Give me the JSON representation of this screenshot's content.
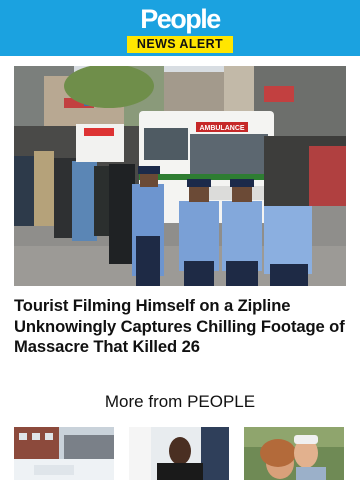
{
  "header": {
    "brand": "People",
    "badge": "NEWS ALERT",
    "background": "#1BA2E0",
    "badge_color": "#FFE600"
  },
  "hero": {
    "description_icon": "photo-street-scene",
    "ambulance_sign": "AMBULANCE"
  },
  "article": {
    "headline": "Tourist Filming Himself on a Zipline Unknowingly Captures Chilling Footage of Massacre That Killed 26"
  },
  "more": {
    "title": "More from PEOPLE",
    "thumbnails": [
      {
        "icon": "photo-snowy-building"
      },
      {
        "icon": "photo-young-man"
      },
      {
        "icon": "photo-couple-selfie"
      }
    ]
  }
}
